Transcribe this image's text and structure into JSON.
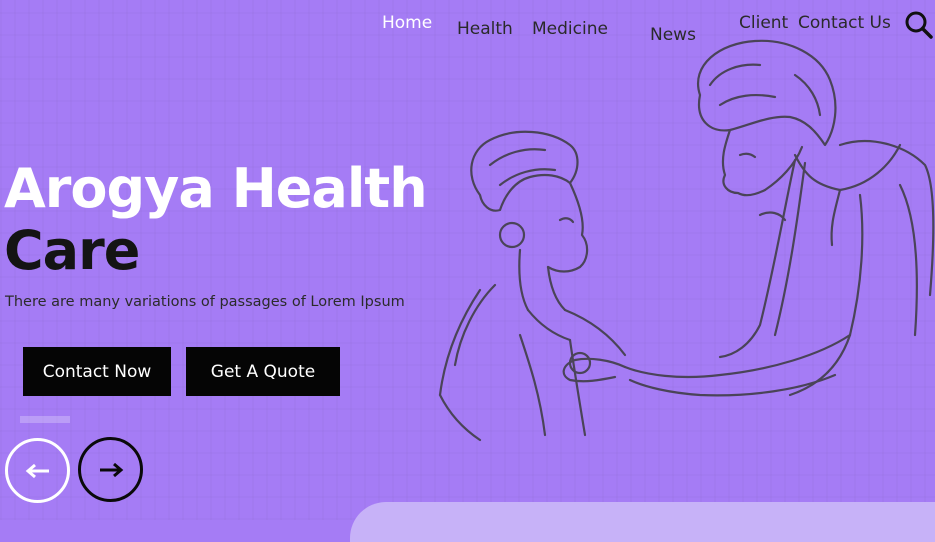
{
  "nav": {
    "items": [
      {
        "label": "Home",
        "active": true
      },
      {
        "label": "Health",
        "active": false
      },
      {
        "label": "Medicine",
        "active": false
      },
      {
        "label": "News",
        "active": false
      },
      {
        "label": "Client",
        "active": false
      },
      {
        "label": "Contact Us",
        "active": false
      }
    ],
    "search_icon": "search-icon"
  },
  "hero": {
    "title_line1": "Arogya Health",
    "title_line2": "Care",
    "subtitle": "There are many variations of passages of Lorem Ipsum",
    "primary_button": "Contact Now",
    "secondary_button": "Get A Quote"
  },
  "slider": {
    "prev_icon": "arrow-left-icon",
    "next_icon": "arrow-right-icon"
  },
  "colors": {
    "background": "#a57cf5",
    "button_bg": "#050505",
    "active_nav": "#ffffff",
    "bottom_panel": "#c7b2f8"
  },
  "illustration": "doctor-examining-boy-illustration"
}
